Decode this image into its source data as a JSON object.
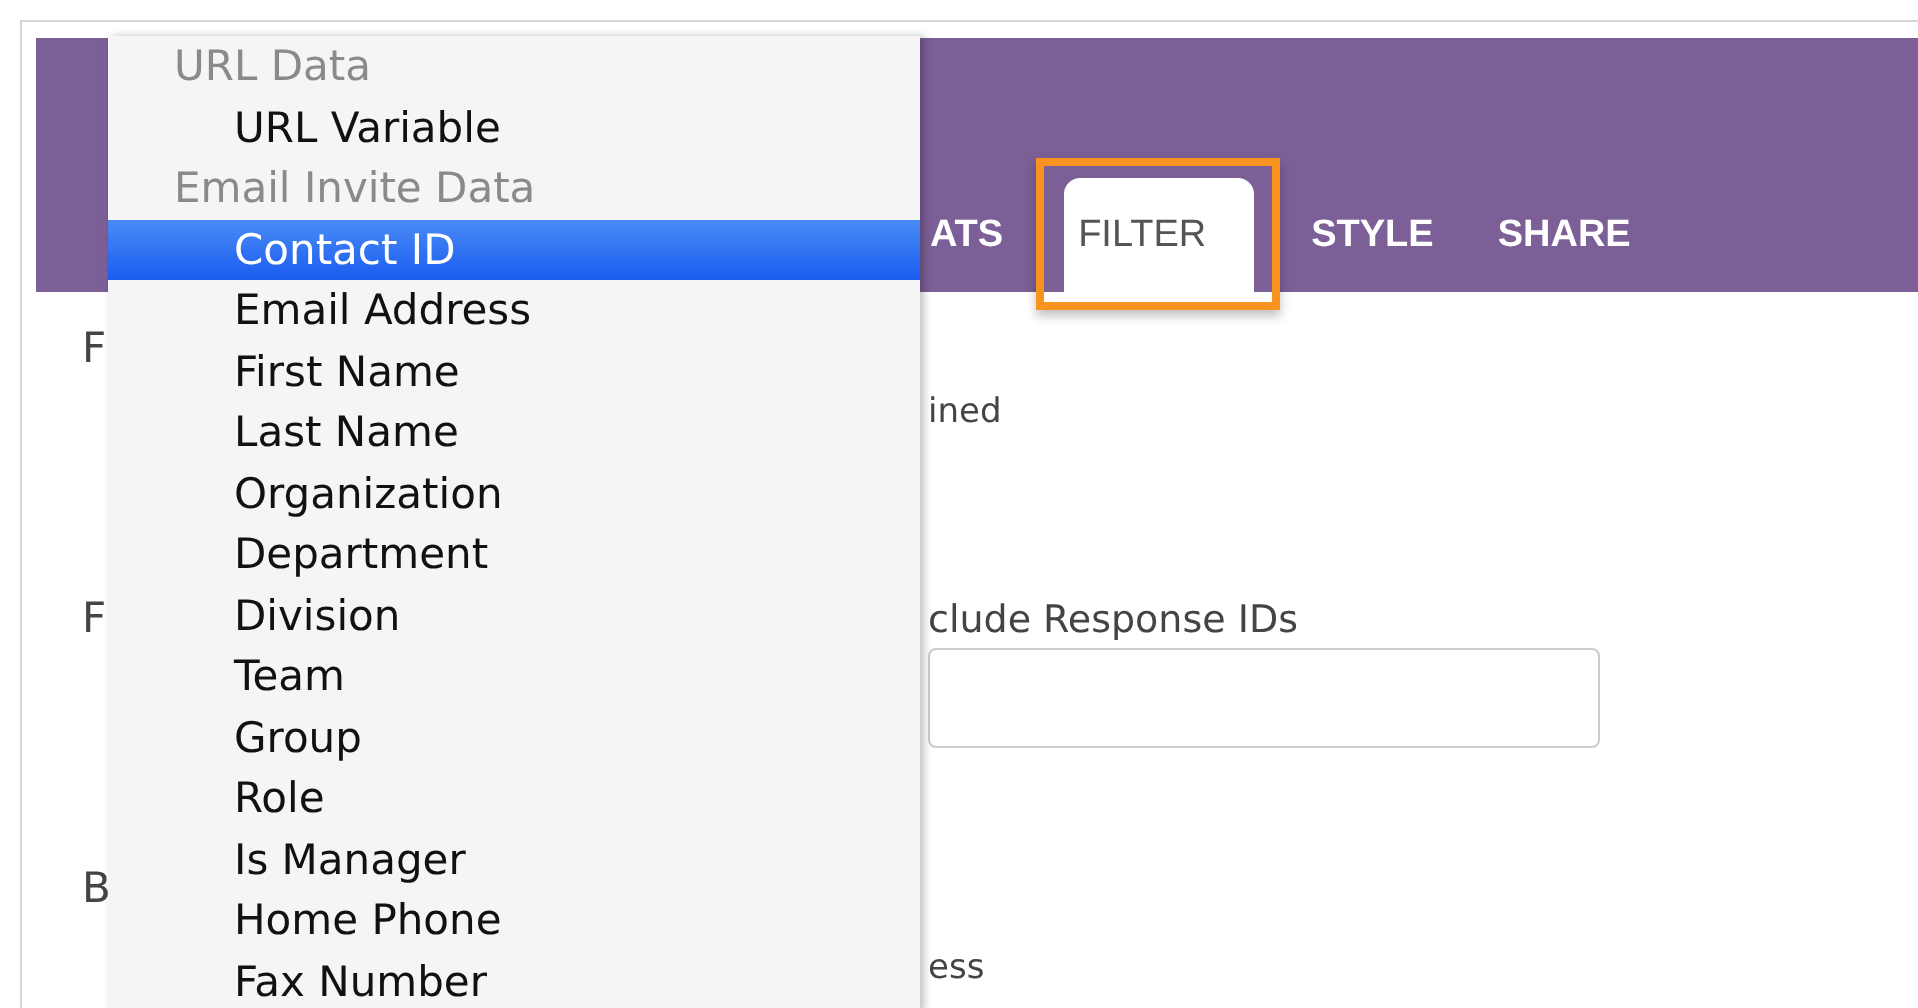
{
  "header": {
    "tabs": [
      {
        "label": "ATS",
        "selected": false,
        "highlighted": false
      },
      {
        "label": "FILTER",
        "selected": true,
        "highlighted": true
      },
      {
        "label": "STYLE",
        "selected": false,
        "highlighted": false
      },
      {
        "label": "SHARE",
        "selected": false,
        "highlighted": false
      }
    ]
  },
  "content": {
    "rows": [
      {
        "kind": "heading",
        "left": "F",
        "right": ""
      },
      {
        "kind": "note",
        "left": "",
        "right": "ined"
      },
      {
        "kind": "labels",
        "left": "F",
        "right": "clude Response IDs"
      },
      {
        "kind": "field",
        "left": "",
        "right": ""
      },
      {
        "kind": "heading",
        "left": "B",
        "right": ""
      },
      {
        "kind": "note",
        "left": "",
        "right": "ess"
      }
    ]
  },
  "dropdown": {
    "items": [
      {
        "kind": "group",
        "label": "URL Data",
        "selected": false
      },
      {
        "kind": "item",
        "label": "URL Variable",
        "selected": false
      },
      {
        "kind": "group",
        "label": "Email Invite Data",
        "selected": false
      },
      {
        "kind": "item",
        "label": "Contact ID",
        "selected": true
      },
      {
        "kind": "item",
        "label": "Email Address",
        "selected": false
      },
      {
        "kind": "item",
        "label": "First Name",
        "selected": false
      },
      {
        "kind": "item",
        "label": "Last Name",
        "selected": false
      },
      {
        "kind": "item",
        "label": "Organization",
        "selected": false
      },
      {
        "kind": "item",
        "label": "Department",
        "selected": false
      },
      {
        "kind": "item",
        "label": "Division",
        "selected": false
      },
      {
        "kind": "item",
        "label": "Team",
        "selected": false
      },
      {
        "kind": "item",
        "label": "Group",
        "selected": false
      },
      {
        "kind": "item",
        "label": "Role",
        "selected": false
      },
      {
        "kind": "item",
        "label": "Is Manager",
        "selected": false
      },
      {
        "kind": "item",
        "label": "Home Phone",
        "selected": false
      },
      {
        "kind": "item",
        "label": "Fax Number",
        "selected": false
      }
    ]
  }
}
